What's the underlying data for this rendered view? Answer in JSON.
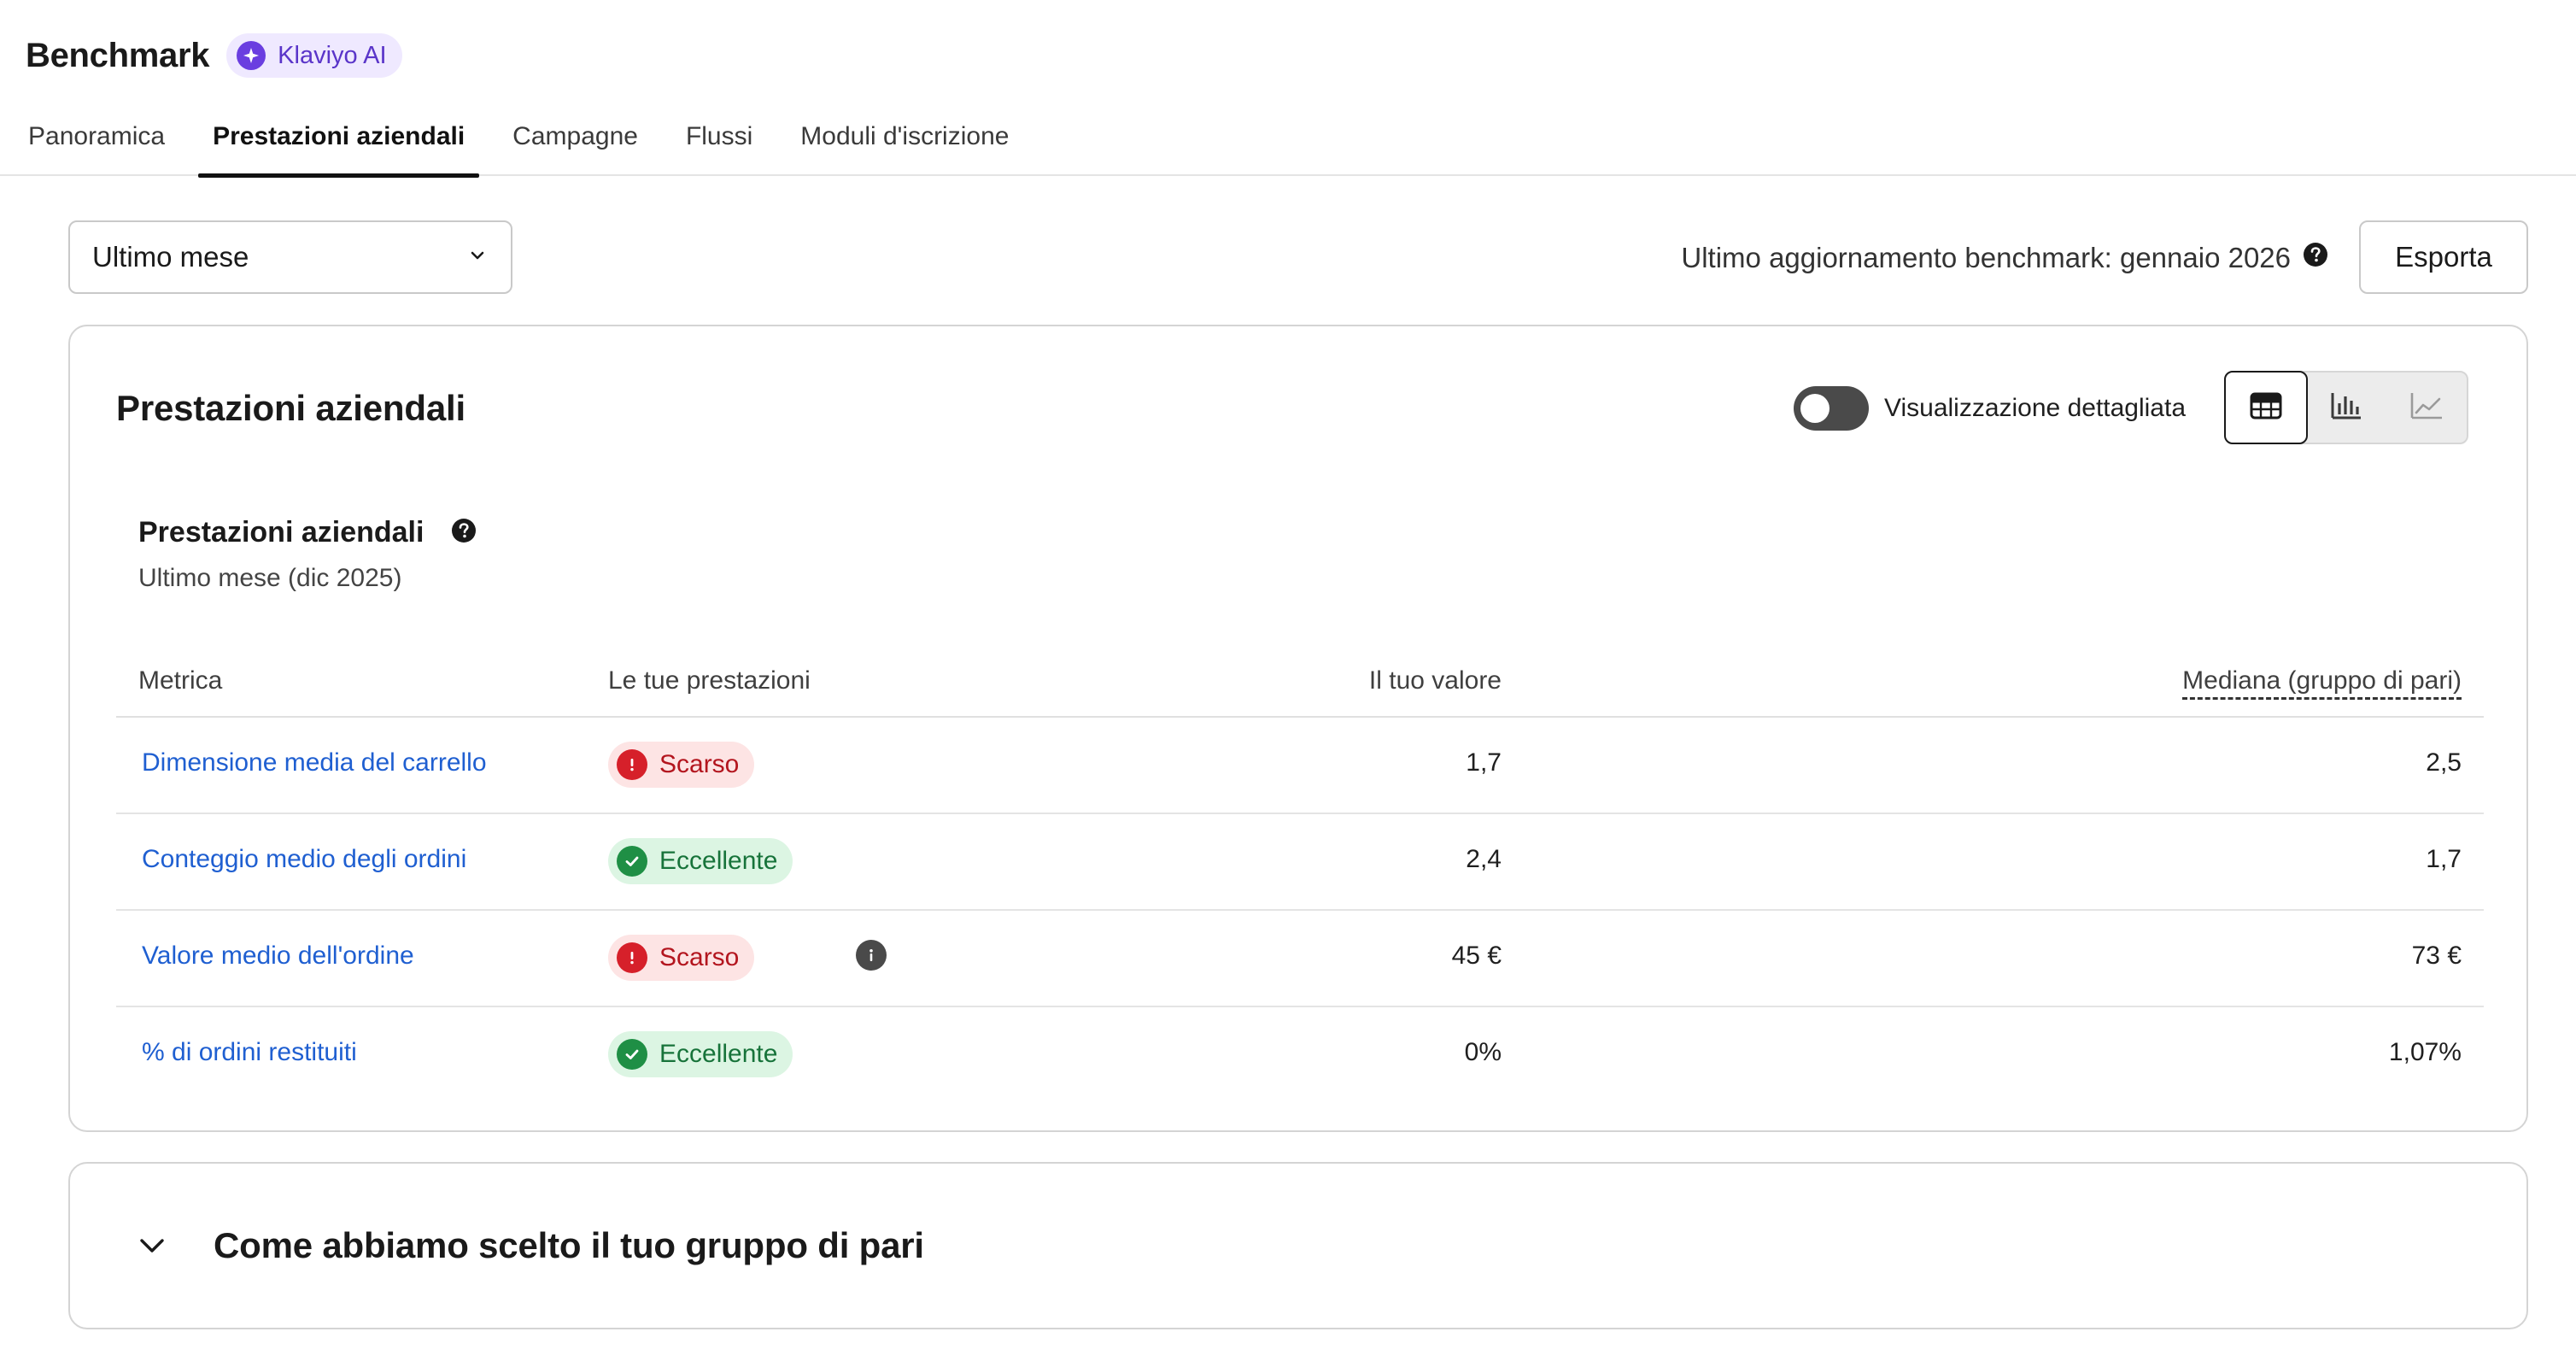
{
  "header": {
    "title": "Benchmark",
    "ai_badge": "Klaviyo AI",
    "tabs": [
      {
        "label": "Panoramica"
      },
      {
        "label": "Prestazioni aziendali"
      },
      {
        "label": "Campagne"
      },
      {
        "label": "Flussi"
      },
      {
        "label": "Moduli d'iscrizione"
      }
    ],
    "active_tab": "Prestazioni aziendali"
  },
  "toolbar": {
    "period_value": "Ultimo mese",
    "update_text": "Ultimo aggiornamento benchmark: gennaio 2026",
    "export_label": "Esporta"
  },
  "card": {
    "title": "Prestazioni aziendali",
    "toggle_label": "Visualizzazione dettagliata",
    "toggle_on": false,
    "view_modes": [
      "table-icon",
      "bar-chart-icon",
      "line-chart-icon"
    ],
    "active_view": "table-icon",
    "section_title": "Prestazioni aziendali",
    "section_subtitle": "Ultimo mese (dic 2025)",
    "columns": {
      "metric": "Metrica",
      "performance": "Le tue prestazioni",
      "value": "Il tuo valore",
      "median": "Mediana (gruppo di pari)"
    },
    "rows": [
      {
        "metric": "Dimensione media del carrello",
        "status": "Scarso",
        "value": "1,7",
        "median": "2,5"
      },
      {
        "metric": "Conteggio medio degli ordini",
        "status": "Eccellente",
        "value": "2,4",
        "median": "1,7"
      },
      {
        "metric": "Valore medio dell'ordine",
        "status": "Scarso",
        "value": "45 €",
        "median": "73 €"
      },
      {
        "metric": "% di ordini restituiti",
        "status": "Eccellente",
        "value": "0%",
        "median": "1,07%"
      }
    ]
  },
  "accordion": {
    "title": "Come abbiamo scelto il tuo gruppo di pari"
  },
  "colors": {
    "link": "#1f5fd1",
    "poor": "#d6202a",
    "excellent": "#1f8f45",
    "ai_accent": "#6a3ee0"
  }
}
